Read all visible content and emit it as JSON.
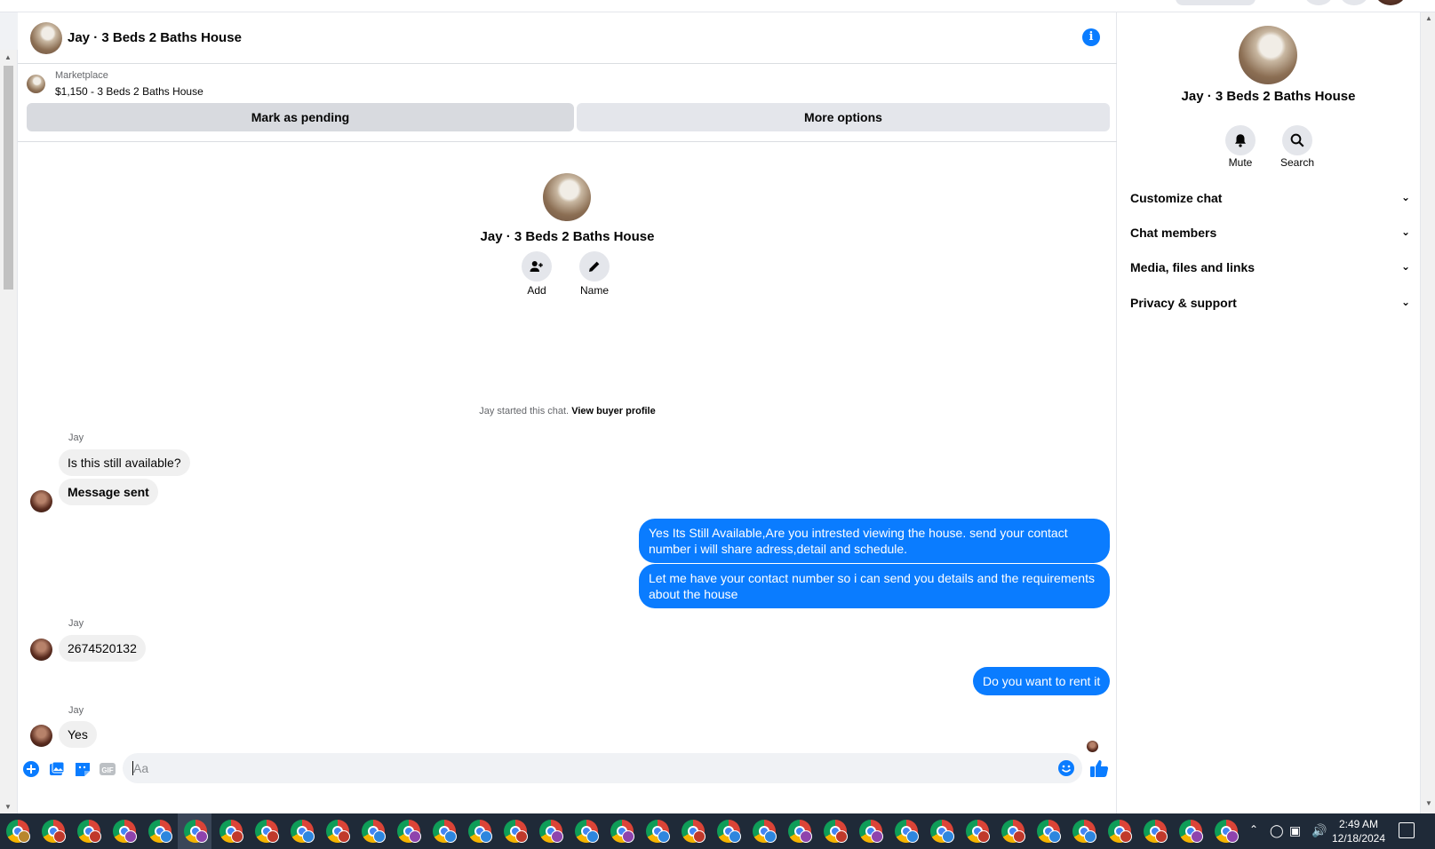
{
  "chat": {
    "title": "Jay · 3 Beds 2 Baths House",
    "marketplace_caption": "Marketplace",
    "listing": "$1,150 - 3 Beds 2 Baths House",
    "mark_pending": "Mark as pending",
    "more_options": "More options",
    "intro_name": "Jay · 3 Beds 2 Baths House",
    "add_label": "Add",
    "name_label": "Name",
    "started_text": "Jay started this chat.",
    "view_profile": "View buyer profile",
    "sender": "Jay",
    "messages_in_1": "Is this still available?",
    "messages_in_2": "Message sent",
    "messages_out_1": "Yes Its Still Available,Are you intrested viewing the house. send your contact number i will share adress,detail and schedule.",
    "messages_out_2": "Let me have your contact number so i can send you details and the requirements about the house",
    "messages_in_3": "2674520132",
    "messages_out_3": "Do you want to rent it",
    "messages_in_4": "Yes",
    "composer_placeholder": "Aa"
  },
  "side": {
    "name": "Jay · 3 Beds 2 Baths House",
    "mute": "Mute",
    "search": "Search",
    "rows": [
      "Customize chat",
      "Chat members",
      "Media, files and links",
      "Privacy & support"
    ]
  },
  "taskbar": {
    "time": "2:49 AM",
    "date": "12/18/2024"
  },
  "colors": {
    "accent": "#0a7cff",
    "bubble_in": "#f0f0f0",
    "taskbar": "#1f2a38"
  },
  "icons": [
    "info-icon",
    "person-add-icon",
    "pencil-icon",
    "bell-icon",
    "search-icon",
    "chevron-down-icon",
    "plus-circle-icon",
    "image-icon",
    "sticker-icon",
    "gif-icon",
    "emoji-icon",
    "thumbs-up-icon",
    "chrome-icon"
  ]
}
